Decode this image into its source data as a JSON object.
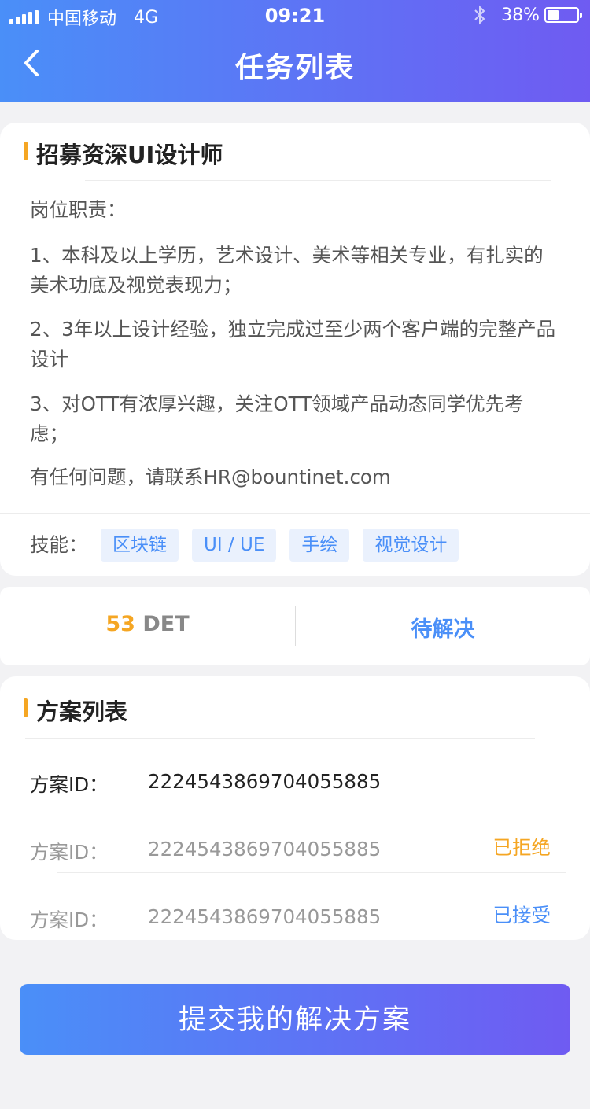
{
  "status_bar": {
    "carrier": "中国移动",
    "network": "4G",
    "time": "09:21",
    "battery": "38%",
    "battery_level": 0.38
  },
  "header": {
    "title": "任务列表",
    "back_icon": "chevron-left-icon"
  },
  "task": {
    "title": "招募资深UI设计师",
    "responsibilities_label": "岗位职责：",
    "items": [
      "1、本科及以上学历，艺术设计、美术等相关专业，有扎实的美术功底及视觉表现力；",
      "2、3年以上设计经验，独立完成过至少两个客户端的完整产品设计",
      "3、对OTT有浓厚兴趣，关注OTT领域产品动态同学优先考虑；"
    ],
    "contact": "有任何问题，请联系HR@bountinet.com",
    "skills_label": "技能：",
    "skills": [
      "区块链",
      "UI / UE",
      "手绘",
      "视觉设计"
    ]
  },
  "reward": {
    "amount": "53",
    "unit": "DET",
    "status": "待解决"
  },
  "solutions": {
    "title": "方案列表",
    "rows": [
      {
        "label": "方案ID：",
        "id": "2224543869704055885",
        "status": ""
      },
      {
        "label": "方案ID：",
        "id": "2224543869704055885",
        "status": "已拒绝"
      },
      {
        "label": "方案ID：",
        "id": "2224543869704055885",
        "status": "已接受"
      }
    ]
  },
  "submit_label": "提交我的解决方案",
  "colors": {
    "accent_blue": "#4a8ff8",
    "accent_purple": "#6f5bf2",
    "accent_orange": "#f5a623"
  }
}
